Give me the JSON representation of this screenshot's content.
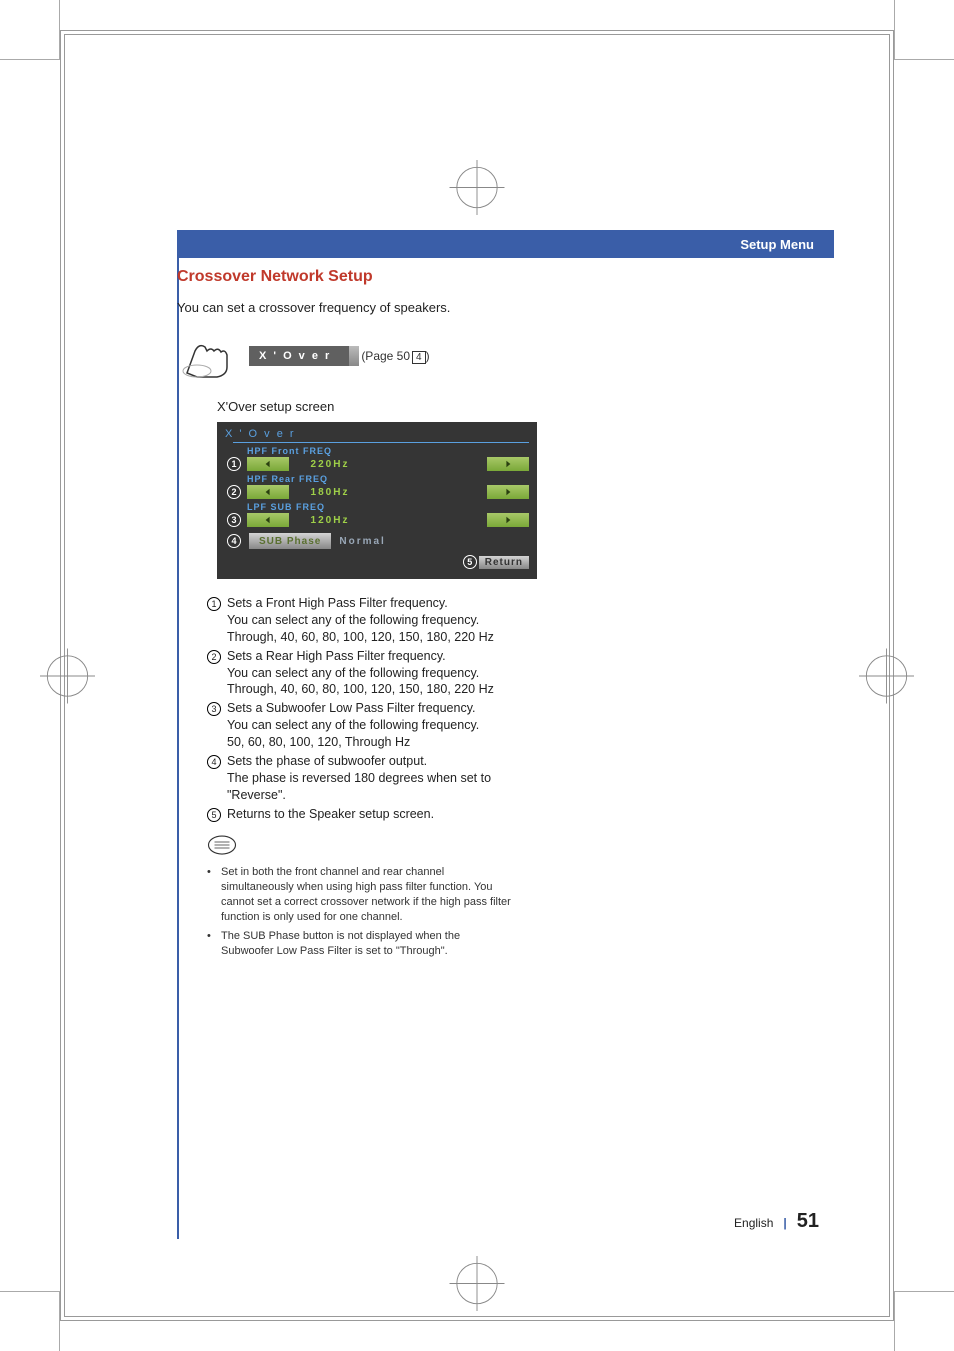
{
  "header": {
    "title": "Setup Menu"
  },
  "section": {
    "title": "Crossover Network Setup"
  },
  "intro": "You can set a crossover frequency of speakers.",
  "barbtn": {
    "label": "X ' O v e r"
  },
  "pageref": {
    "prefix": "(Page 50",
    "box": "4",
    "suffix": ")"
  },
  "subheading": "X'Over setup screen",
  "device": {
    "title": "X ' O v e r",
    "rows": [
      {
        "num": "1",
        "label": "HPF Front FREQ",
        "value": "220Hz"
      },
      {
        "num": "2",
        "label": "HPF Rear FREQ",
        "value": "180Hz"
      },
      {
        "num": "3",
        "label": "LPF SUB FREQ",
        "value": "120Hz"
      }
    ],
    "phase": {
      "num": "4",
      "label": "SUB Phase",
      "value": "Normal"
    },
    "return": {
      "num": "5",
      "label": "Return"
    }
  },
  "items": [
    {
      "num": "1",
      "head": "Sets a Front High Pass Filter frequency.",
      "l2": "You can select any of the following frequency.",
      "l3": "Through, 40, 60, 80, 100, 120, 150, 180, 220 Hz"
    },
    {
      "num": "2",
      "head": "Sets a Rear High Pass Filter frequency.",
      "l2": "You can select any of the following frequency.",
      "l3": "Through, 40, 60, 80, 100, 120, 150, 180, 220 Hz"
    },
    {
      "num": "3",
      "head": "Sets a Subwoofer Low Pass Filter frequency.",
      "l2": "You can select any of the following frequency.",
      "l3": "50, 60, 80, 100, 120, Through Hz"
    },
    {
      "num": "4",
      "head": "Sets the phase of subwoofer output.",
      "l2": "The phase is reversed 180 degrees when set to \"Reverse\".",
      "l3": ""
    },
    {
      "num": "5",
      "head": "Returns to the Speaker setup screen.",
      "l2": "",
      "l3": ""
    }
  ],
  "notes": [
    "Set in both the front channel and rear channel simultaneously when using high pass filter function. You cannot set a correct crossover network if the high pass filter function is only used for one channel.",
    "The SUB Phase button is not displayed when the Subwoofer Low Pass Filter is set to \"Through\"."
  ],
  "footer": {
    "lang": "English",
    "page": "51"
  }
}
